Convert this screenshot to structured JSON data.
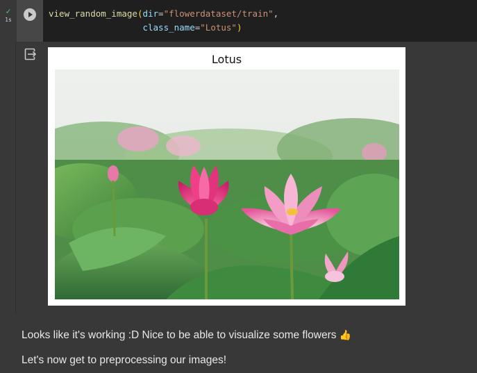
{
  "code_cell": {
    "status_icon": "check-icon",
    "exec_time": "1s",
    "run_icon": "play-icon",
    "code": {
      "fn": "view_random_image",
      "open_paren": "(",
      "param1": "dir",
      "eq1": "=",
      "str1": "\"flowerdataset/train\"",
      "comma": ",",
      "indent": "                  ",
      "param2": "class_name",
      "eq2": "=",
      "str2": "\"Lotus\"",
      "close_paren": ")"
    }
  },
  "output": {
    "icon": "output-redirect-icon",
    "figure_title": "Lotus",
    "image": "lotus-flowers-photo"
  },
  "markdown": {
    "line1": "Looks like it's working :D Nice to be able to visualize some flowers",
    "line1_emoji": "👍",
    "line2": "Let's now get to preprocessing our images!"
  },
  "colors": {
    "background": "#383838",
    "editor_bg": "#1f1f1f",
    "run_check": "#5bbf6a",
    "string": "#ce9178",
    "function": "#dcdcaa",
    "param": "#9cdcfe",
    "paren": "#f5d23d"
  }
}
